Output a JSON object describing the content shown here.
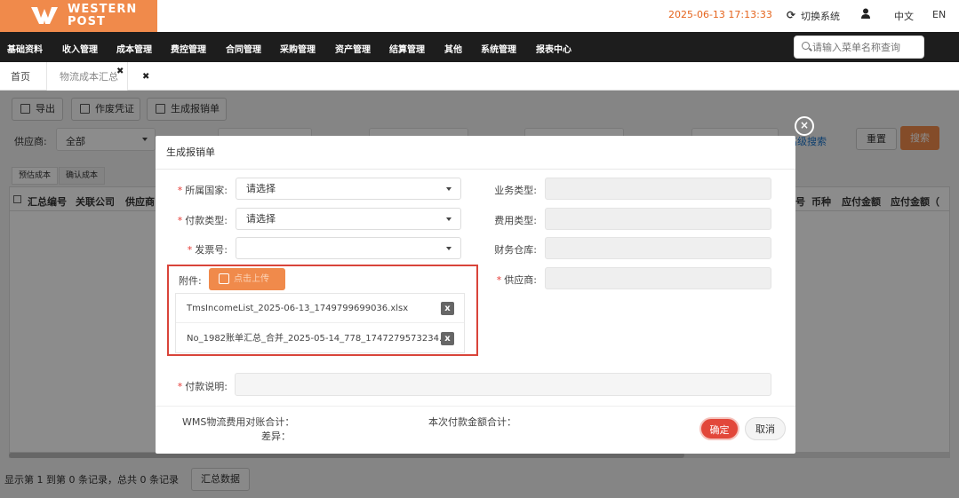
{
  "header": {
    "logo_line1": "WESTERN",
    "logo_line2": "POST",
    "datetime": "2025-06-13 17:13:33",
    "switch_system": "切换系统",
    "lang_zh": "中文",
    "lang_en": "EN"
  },
  "nav": {
    "items": [
      "基础资料",
      "收入管理",
      "成本管理",
      "费控管理",
      "合同管理",
      "采购管理",
      "资产管理",
      "结算管理",
      "其他",
      "系统管理",
      "报表中心"
    ],
    "search_placeholder": "请输入菜单名称查询"
  },
  "tabs": {
    "home": "首页",
    "current": "物流成本汇总",
    "close_glyph": "✖",
    "close_all_glyph": "✖"
  },
  "page": {
    "buttons": {
      "export": "导出",
      "void_voucher": "作废凭证",
      "generate_reimburse": "生成报销单"
    },
    "filter": {
      "supplier_label": "供应商:",
      "supplier_value": "全部",
      "advanced_search": "高级搜索",
      "reset": "重置",
      "search": "搜索"
    },
    "subtabs": [
      "预估成本",
      "确认成本"
    ],
    "columns": [
      "汇总编号",
      "关联公司",
      "供应商",
      "号",
      "币种",
      "应付金额",
      "应付金额（"
    ],
    "record_info": "显示第 1 到第 0 条记录，总共 0 条记录",
    "summary_button": "汇总数据"
  },
  "modal": {
    "title": "生成报销单",
    "country_label": "所属国家:",
    "country_value": "请选择",
    "pay_type_label": "付款类型:",
    "pay_type_value": "请选择",
    "invoice_label": "发票号:",
    "invoice_value": "",
    "business_type_label": "业务类型:",
    "fee_type_label": "费用类型:",
    "warehouse_label": "财务仓库:",
    "supplier_label": "供应商:",
    "attachment_label": "附件:",
    "upload_label": "点击上传",
    "files": [
      "TmsIncomeList_2025-06-13_1749799699036.xlsx",
      "No_1982账单汇总_合并_2025-05-14_778_1747279573234.zip"
    ],
    "delete_glyph": "x",
    "pay_note_label": "付款说明:",
    "wms_total_label": "WMS物流费用对账合计：",
    "diff_label": "差异：",
    "this_pay_total_label": "本次付款金额合计：",
    "ok": "确定",
    "cancel": "取消",
    "close_glyph": "×"
  },
  "colors": {
    "brand": "#f08a4b",
    "nav_bg": "#1d1d1d",
    "danger": "#e2473a",
    "highlight_border": "#d9443a"
  }
}
